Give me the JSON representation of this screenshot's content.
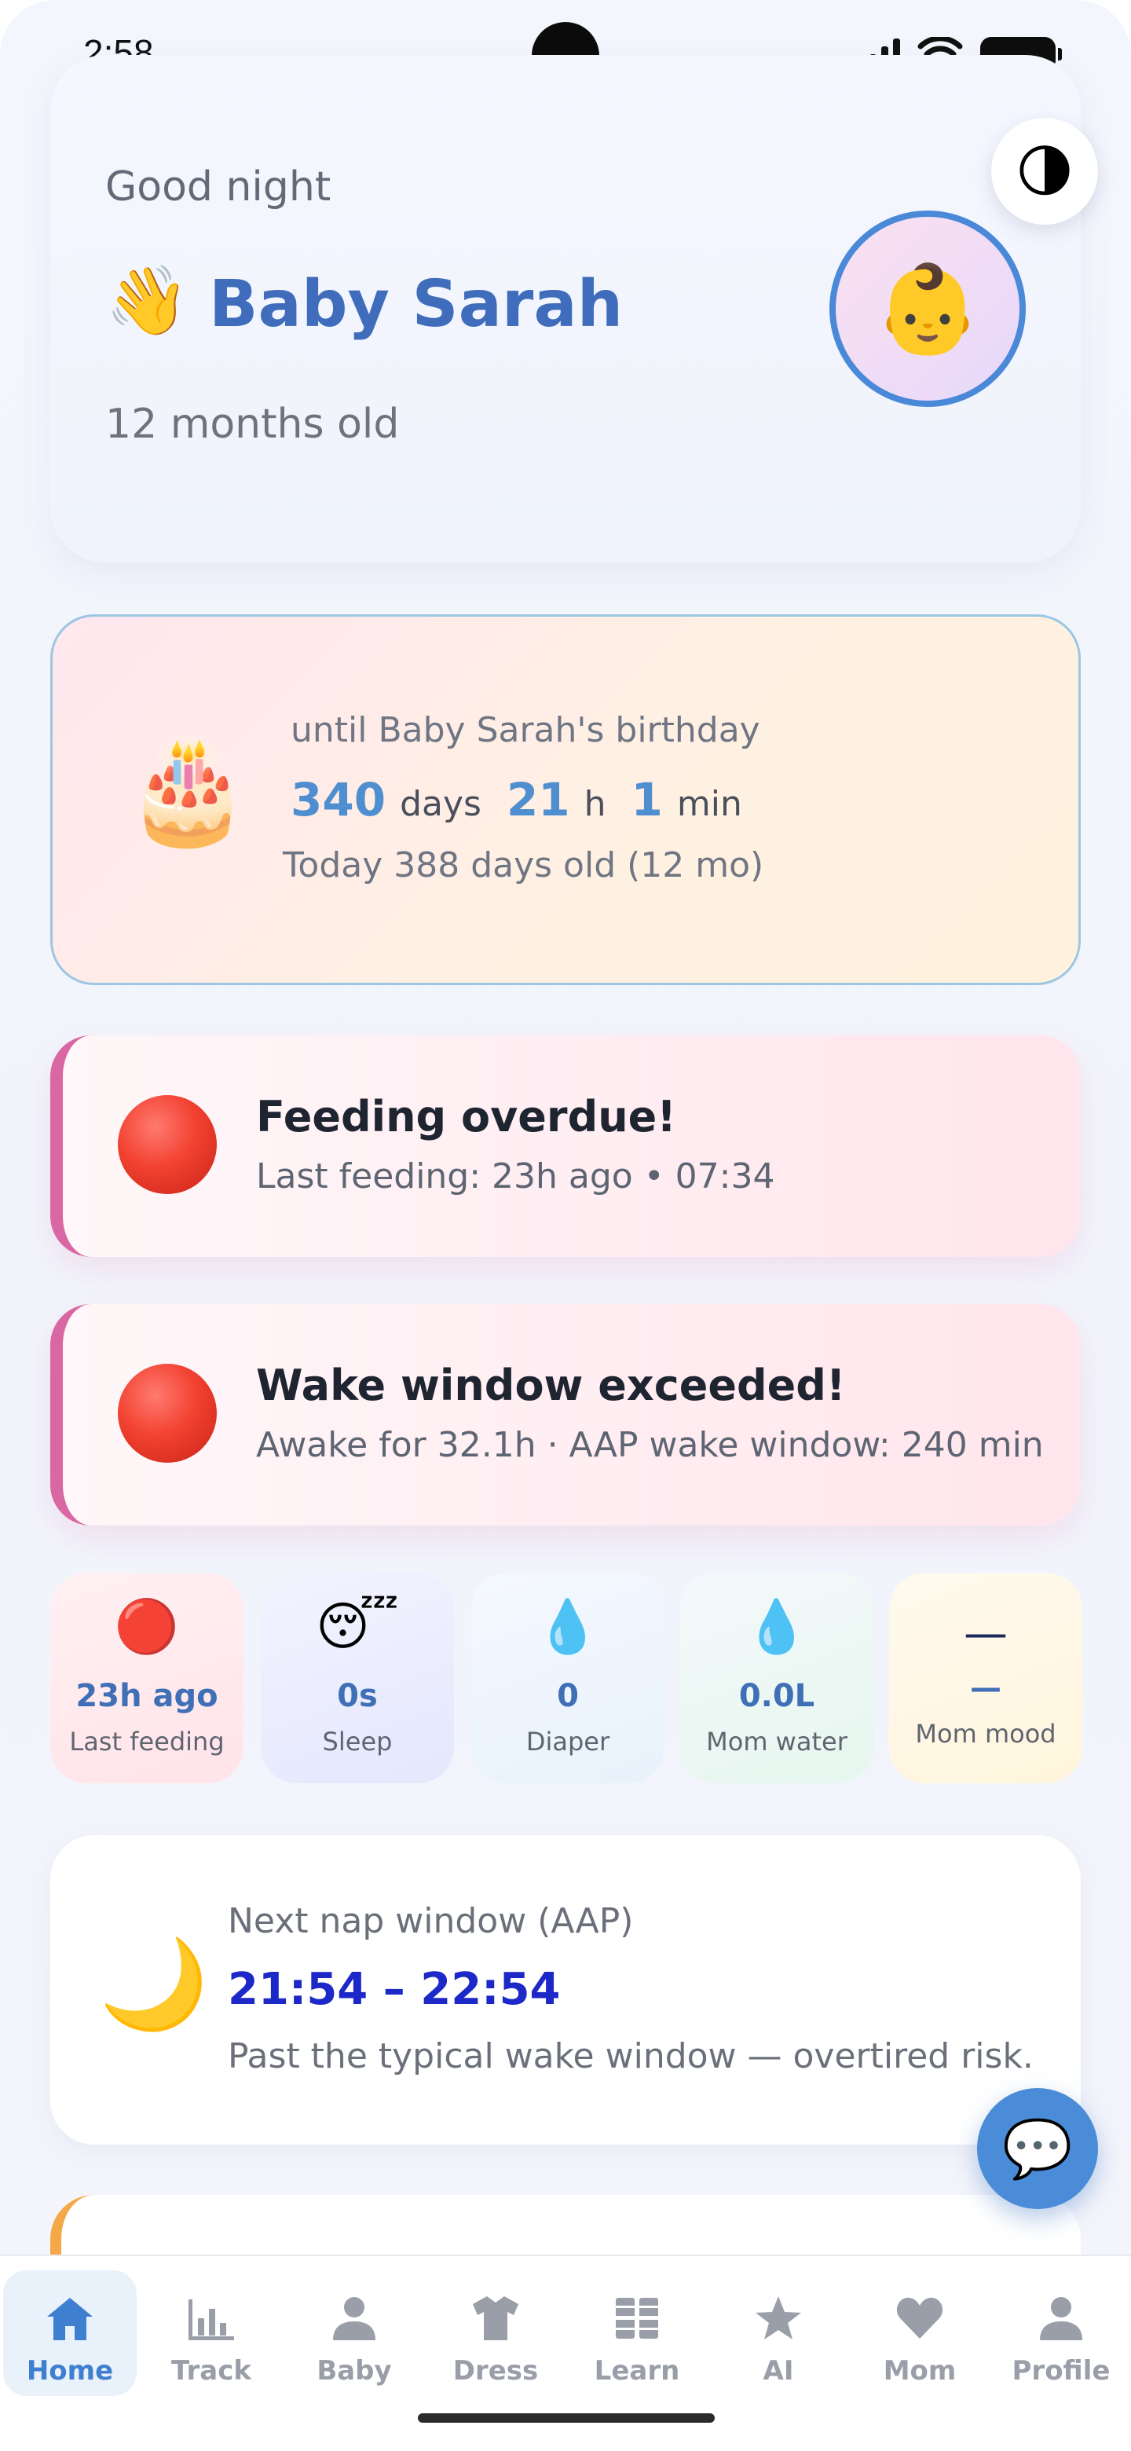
{
  "status_bar": {
    "time": "2:58"
  },
  "header": {
    "greeting": "Good night",
    "wave_emoji": "👋",
    "baby_name": "Baby Sarah",
    "age": "12 months old",
    "theme_icon": "🌗",
    "avatar_emoji": "👶"
  },
  "birthday": {
    "cake_emoji": "🎂",
    "until_text": "until Baby Sarah's birthday",
    "days": "340",
    "days_unit": "days",
    "hours": "21",
    "hours_unit": "h",
    "minutes": "1",
    "minutes_unit": "min",
    "today_text": "Today 388 days old (12 mo)"
  },
  "alerts": [
    {
      "title": "Feeding overdue!",
      "subtitle": "Last feeding: 23h ago • 07:34"
    },
    {
      "title": "Wake window exceeded!",
      "subtitle": "Awake for 32.1h · AAP wake window: 240 min"
    }
  ],
  "stats": [
    {
      "icon": "🔴",
      "value": "23h ago",
      "label": "Last feeding"
    },
    {
      "icon": "😴",
      "value": "0s",
      "label": "Sleep"
    },
    {
      "icon": "💧",
      "value": "0",
      "label": "Diaper"
    },
    {
      "icon": "💧",
      "value": "0.0L",
      "label": "Mom water"
    },
    {
      "icon": "—",
      "value": "—",
      "label": "Mom mood"
    }
  ],
  "nap": {
    "moon_emoji": "🌙",
    "title": "Next nap window (AAP)",
    "time": "21:54 – 22:54",
    "note": "Past the typical wake window — overtired risk."
  },
  "chat_icon": "💬",
  "nav": [
    {
      "label": "Home",
      "icon": "home-icon"
    },
    {
      "label": "Track",
      "icon": "bar-chart-icon"
    },
    {
      "label": "Baby",
      "icon": "person-icon"
    },
    {
      "label": "Dress",
      "icon": "shirt-icon"
    },
    {
      "label": "Learn",
      "icon": "grid-icon"
    },
    {
      "label": "AI",
      "icon": "star-icon"
    },
    {
      "label": "Mom",
      "icon": "heart-icon"
    },
    {
      "label": "Profile",
      "icon": "profile-icon"
    }
  ],
  "colors": {
    "accent": "#4a8cd8",
    "name_blue": "#3f6dbb",
    "alert_red": "#f24130",
    "nap_time": "#1c28c8"
  }
}
